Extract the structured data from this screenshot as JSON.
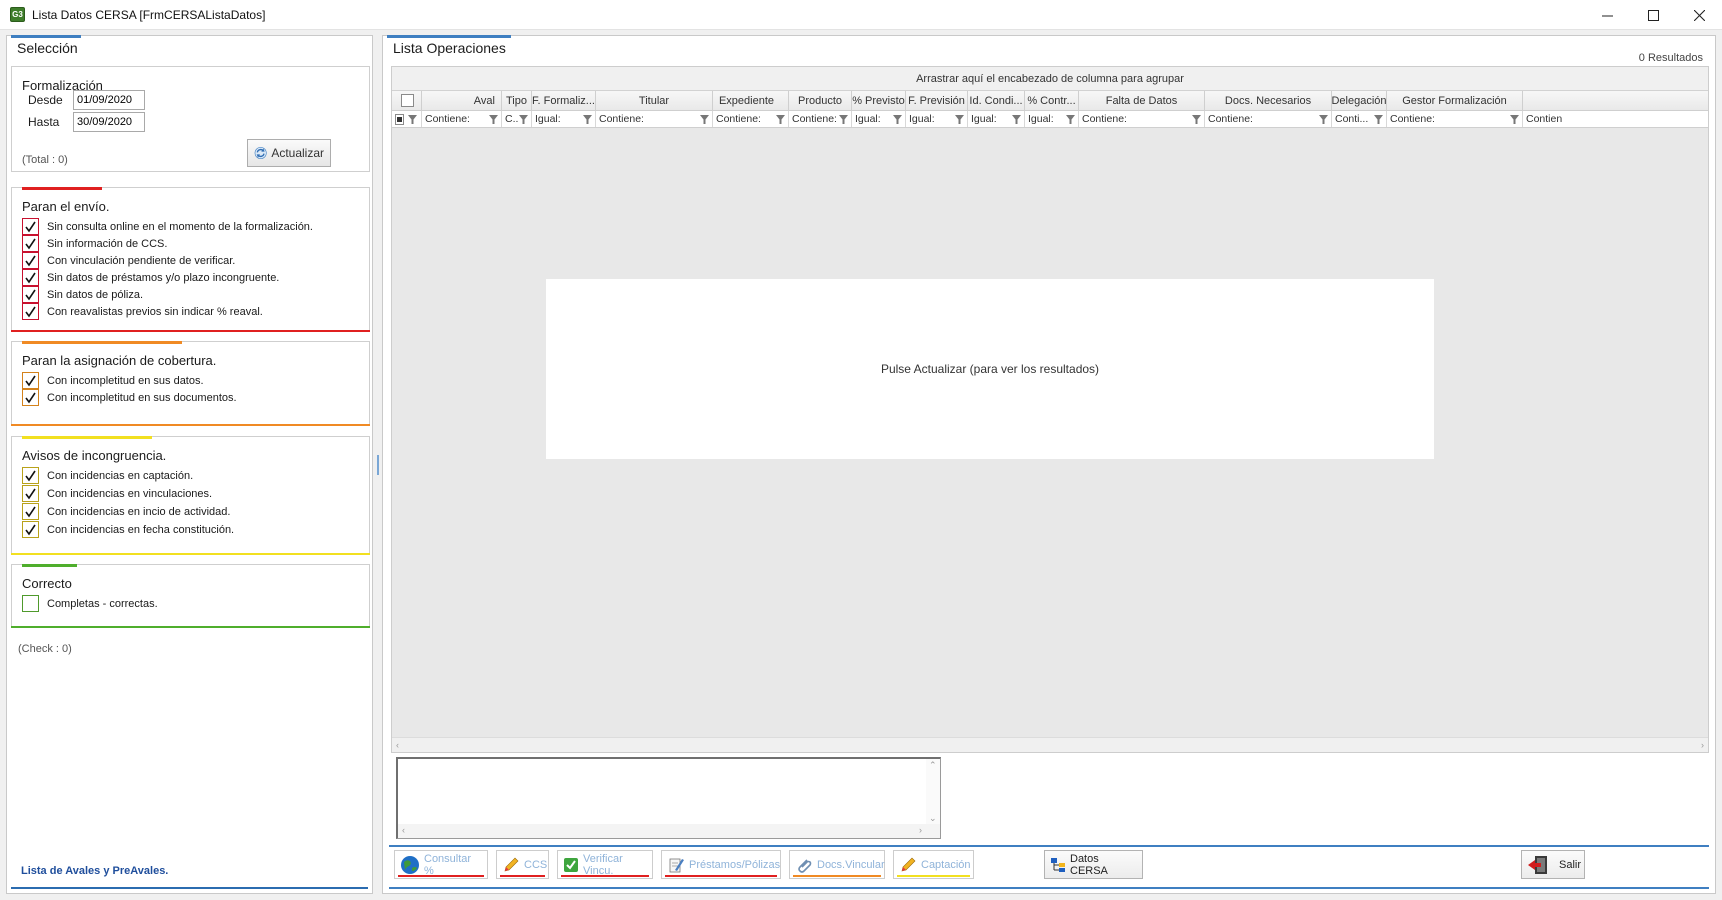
{
  "window": {
    "title": "Lista Datos CERSA [FrmCERSAListaDatos]",
    "icon_text": "G3",
    "minimize_icon": "minimize-icon",
    "maximize_icon": "maximize-icon",
    "close_icon": "close-icon"
  },
  "left": {
    "title": "Selección",
    "formalizacion": {
      "title": "Formalización",
      "desde_label": "Desde",
      "desde_value": "01/09/2020",
      "hasta_label": "Hasta",
      "hasta_value": "30/09/2020",
      "actualizar_label": "Actualizar",
      "total_text": "(Total :  0)"
    },
    "paran_envio": {
      "title": "Paran el envío.",
      "color": "#e02020",
      "items": [
        {
          "label": "Sin consulta online en el momento de la formalización.",
          "checked": true
        },
        {
          "label": "Sin información de CCS.",
          "checked": true
        },
        {
          "label": "Con vinculación pendiente de verificar.",
          "checked": true
        },
        {
          "label": "Sin datos de préstamos y/o plazo incongruente.",
          "checked": true
        },
        {
          "label": "Sin datos de póliza.",
          "checked": true
        },
        {
          "label": "Con reavalistas previos sin indicar % reaval.",
          "checked": true
        }
      ]
    },
    "paran_cobertura": {
      "title": "Paran la asignación de cobertura.",
      "color": "#f08a24",
      "items": [
        {
          "label": "Con incompletitud en sus datos.",
          "checked": true
        },
        {
          "label": "Con incompletitud en sus documentos.",
          "checked": true
        }
      ]
    },
    "avisos": {
      "title": "Avisos de incongruencia.",
      "color": "#f2e020",
      "items": [
        {
          "label": "Con incidencias en captación.",
          "checked": true
        },
        {
          "label": "Con incidencias en vinculaciones.",
          "checked": true
        },
        {
          "label": "Con incidencias en incio de actividad.",
          "checked": true
        },
        {
          "label": "Con incidencias en  fecha constitución.",
          "checked": true
        }
      ]
    },
    "correcto": {
      "title": "Correcto",
      "color": "#4fae2c",
      "items": [
        {
          "label": "Completas - correctas.",
          "checked": false
        }
      ]
    },
    "check_text": "(Check :  0)",
    "footer_link": "Lista de Avales y PreAvales."
  },
  "right": {
    "title": "Lista Operaciones",
    "results": "0 Resultados",
    "group_hint": "Arrastrar aquí el encabezado de columna para agrupar",
    "columns": [
      {
        "label": "Aval",
        "filter": "Contiene:"
      },
      {
        "label": "Tipo",
        "filter": "C..."
      },
      {
        "label": "F. Formaliz...",
        "filter": "Igual:"
      },
      {
        "label": "Titular",
        "filter": "Contiene:"
      },
      {
        "label": "Expediente",
        "filter": "Contiene:"
      },
      {
        "label": "Producto",
        "filter": "Contiene:"
      },
      {
        "label": "% Previsto",
        "filter": "Igual:"
      },
      {
        "label": "F. Previsión",
        "filter": "Igual:"
      },
      {
        "label": "Id. Condi...",
        "filter": "Igual:"
      },
      {
        "label": "% Contr...",
        "filter": "Igual:"
      },
      {
        "label": "Falta de Datos",
        "filter": "Contiene:"
      },
      {
        "label": "Docs. Necesarios",
        "filter": "Contiene:"
      },
      {
        "label": "Delegación",
        "filter": "Conti..."
      },
      {
        "label": "Gestor Formalización",
        "filter": "Contiene:"
      },
      {
        "label": "",
        "filter": "Contien"
      }
    ],
    "empty_message": "Pulse Actualizar (para ver los resultados)",
    "toolbar": {
      "consultar": "Consultar %",
      "ccs": "CCS",
      "verificar": "Verificar Vincu.",
      "prestamos": "Préstamos/Pólizas",
      "docs": "Docs.Vincular",
      "captacion": "Captación",
      "datos_cersa": "Datos CERSA",
      "salir": "Salir"
    }
  }
}
